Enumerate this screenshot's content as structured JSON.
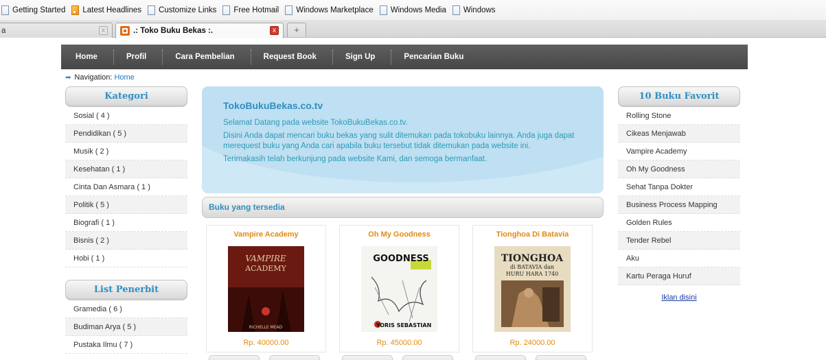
{
  "bookmarks": [
    {
      "label": "Getting Started",
      "icon": "page-icon"
    },
    {
      "label": "Latest Headlines",
      "icon": "rss-icon"
    },
    {
      "label": "Customize Links",
      "icon": "page-icon"
    },
    {
      "label": "Free Hotmail",
      "icon": "page-icon"
    },
    {
      "label": "Windows Marketplace",
      "icon": "page-icon"
    },
    {
      "label": "Windows Media",
      "icon": "page-icon"
    },
    {
      "label": "Windows",
      "icon": "page-icon"
    }
  ],
  "tabs": {
    "inactive_label": "a",
    "active_label": ".: Toko Buku Bekas :.",
    "close_glyph": "x",
    "new_tab_glyph": "+"
  },
  "nav": [
    "Home",
    "Profil",
    "Cara Pembelian",
    "Request Book",
    "Sign Up",
    "Pencarian Buku"
  ],
  "breadcrumb": {
    "prefix": "Navigation:",
    "link": "Home"
  },
  "categories": {
    "title": "Kategori",
    "items": [
      "Sosial  ( 4 )",
      "Pendidikan  ( 5 )",
      "Musik  ( 2 )",
      "Kesehatan  ( 1 )",
      "Cinta Dan Asmara  ( 1 )",
      "Politik  ( 5 )",
      "Biografi  ( 1 )",
      "Bisnis  ( 2 )",
      "Hobi  ( 1 )"
    ]
  },
  "publishers": {
    "title": "List Penerbit",
    "items": [
      "Gramedia  ( 6 )",
      "Budiman Arya  ( 5 )",
      "Pustaka Ilmu  ( 7 )"
    ]
  },
  "welcome": {
    "title": "TokoBukuBekas.co.tv",
    "p1": "Selamat Datang pada website TokoBukuBekas.co.tv.",
    "p2": "Disini Anda dapat mencari buku bekas yang sulit ditemukan pada tokobuku lainnya. Anda juga dapat merequest buku yang Anda cari apabila buku tersebut tidak ditemukan pada website ini.",
    "p3": "Terimakasih telah berkunjung pada website Kami, dan semoga bermanfaat."
  },
  "available": {
    "title": "Buku yang tersedia"
  },
  "products": [
    {
      "title": "Vampire Academy",
      "price": "Rp. 40000.00",
      "cover_title": "VAMPIRE ACADEMY",
      "cover_author": "RICHELLE MEAD",
      "cover_bg": "#6b1a12"
    },
    {
      "title": "Oh My Goodness",
      "price": "Rp. 45000.00",
      "cover_title": "GOODNESS",
      "cover_author": "YORIS SEBASTIAN",
      "cover_bg": "#f4f4f0"
    },
    {
      "title": "Tionghoa Di Batavia",
      "price": "Rp. 24000.00",
      "cover_title": "TIONGHOA",
      "cover_subtitle": "di BATAVIA dan HURU HARA 1740",
      "cover_bg": "#e8dcc0"
    }
  ],
  "favorites": {
    "title": "10 Buku Favorit",
    "items": [
      "Rolling Stone",
      "Cikeas Menjawab",
      "Vampire Academy",
      "Oh My Goodness",
      "Sehat Tanpa Dokter",
      "Business Process Mapping",
      "Golden Rules",
      "Tender Rebel",
      "Aku",
      "Kartu Peraga Huruf"
    ],
    "ad_link": "Iklan disini"
  }
}
